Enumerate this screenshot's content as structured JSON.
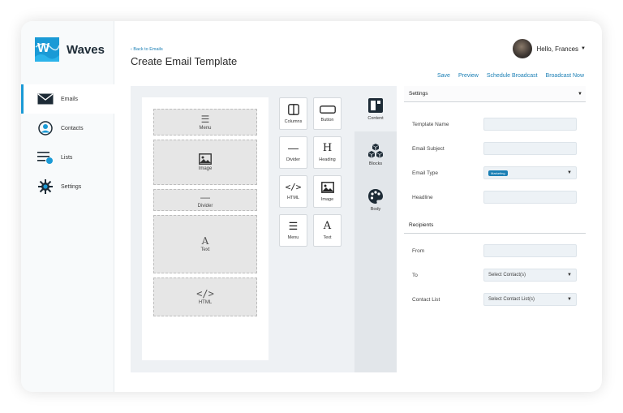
{
  "brand": {
    "name": "Waves",
    "accent": "#1a9ad6"
  },
  "sidebar": {
    "items": [
      {
        "label": "Emails",
        "icon": "envelope-icon",
        "active": true
      },
      {
        "label": "Contacts",
        "icon": "person-icon",
        "active": false
      },
      {
        "label": "Lists",
        "icon": "list-icon",
        "active": false
      },
      {
        "label": "Settings",
        "icon": "gear-icon",
        "active": false
      }
    ]
  },
  "header": {
    "back_label": "Back to Emails",
    "title": "Create Email Template",
    "greeting": "Hello, Frances"
  },
  "actions": {
    "save": "Save",
    "preview": "Preview",
    "schedule": "Schedule Broadcast",
    "broadcast": "Broadcast Now"
  },
  "canvas_blocks": [
    {
      "label": "Menu",
      "icon": "menu-icon"
    },
    {
      "label": "Image",
      "icon": "image-icon"
    },
    {
      "label": "Divider",
      "icon": "divider-icon"
    },
    {
      "label": "Text",
      "icon": "text-icon"
    },
    {
      "label": "HTML",
      "icon": "code-icon"
    }
  ],
  "tiles": [
    {
      "label": "Columns",
      "icon": "columns-icon"
    },
    {
      "label": "Button",
      "icon": "button-icon"
    },
    {
      "label": "Divider",
      "icon": "divider-icon"
    },
    {
      "label": "Heading",
      "icon": "heading-icon"
    },
    {
      "label": "HTML",
      "icon": "code-icon"
    },
    {
      "label": "Image",
      "icon": "image-icon"
    },
    {
      "label": "Menu",
      "icon": "menu-icon"
    },
    {
      "label": "Text",
      "icon": "text-icon"
    }
  ],
  "tabs": [
    {
      "label": "Content",
      "icon": "layout-icon",
      "active": true
    },
    {
      "label": "Blocks",
      "icon": "cubes-icon",
      "active": false
    },
    {
      "label": "Body",
      "icon": "palette-icon",
      "active": false
    }
  ],
  "settings": {
    "heading": "Settings",
    "fields": [
      {
        "label": "Template Name",
        "value": ""
      },
      {
        "label": "Email Subject",
        "value": ""
      },
      {
        "label": "Email Type",
        "value": "Marketing"
      },
      {
        "label": "Headline",
        "value": ""
      }
    ]
  },
  "recipients": {
    "heading": "Recipients",
    "fields": [
      {
        "label": "From",
        "value": ""
      },
      {
        "label": "To",
        "value": "Select Contact(s)"
      },
      {
        "label": "Contact List",
        "value": "Select Contact List(s)"
      }
    ]
  }
}
